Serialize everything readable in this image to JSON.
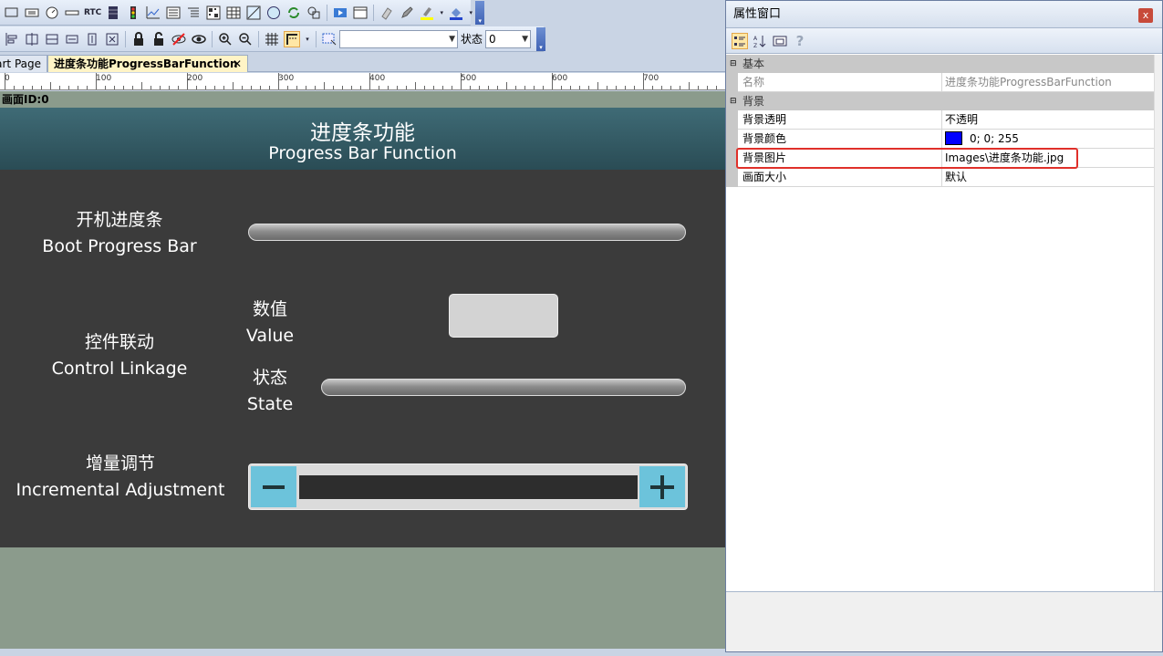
{
  "toolbar": {
    "rtc_label": "RTC",
    "state_label": "状态",
    "state_value": "0"
  },
  "tabs": {
    "start_page": "art Page",
    "progress": "进度条功能ProgressBarFunction",
    "close_glyph": "✕"
  },
  "ruler": {
    "labels": [
      "0",
      "100",
      "200",
      "300",
      "400",
      "500",
      "600",
      "700"
    ]
  },
  "canvas": {
    "screen_id": "画面ID:0"
  },
  "screen": {
    "title_cn": "进度条功能",
    "title_en": "Progress Bar Function",
    "boot_cn": "开机进度条",
    "boot_en": "Boot Progress Bar",
    "linkage_cn": "控件联动",
    "linkage_en": "Control Linkage",
    "value_cn": "数值",
    "value_en": "Value",
    "state_cn": "状态",
    "state_en": "State",
    "incr_cn": "增量调节",
    "incr_en": "Incremental Adjustment",
    "boot_progress": 0.0,
    "state_progress": 0.0
  },
  "props": {
    "title": "属性窗口",
    "close_glyph": "x",
    "help_glyph": "?",
    "categories": {
      "basic": "基本",
      "background": "背景"
    },
    "rows": {
      "name_label": "名称",
      "name_value": "进度条功能ProgressBarFunction",
      "transp_label": "背景透明",
      "transp_value": "不透明",
      "color_label": "背景颜色",
      "color_value": "0; 0; 255",
      "color_hex": "#0000ff",
      "image_label": "背景图片",
      "image_value": "Images\\进度条功能.jpg",
      "size_label": "画面大小",
      "size_value": "默认"
    }
  },
  "colors": {
    "header_teal": "#3f6b76",
    "screen_bg": "#3b3b3b",
    "stepper_button": "#6cc3db",
    "highlight": "#e0302a",
    "canvas_bg": "#8b9b8c"
  }
}
